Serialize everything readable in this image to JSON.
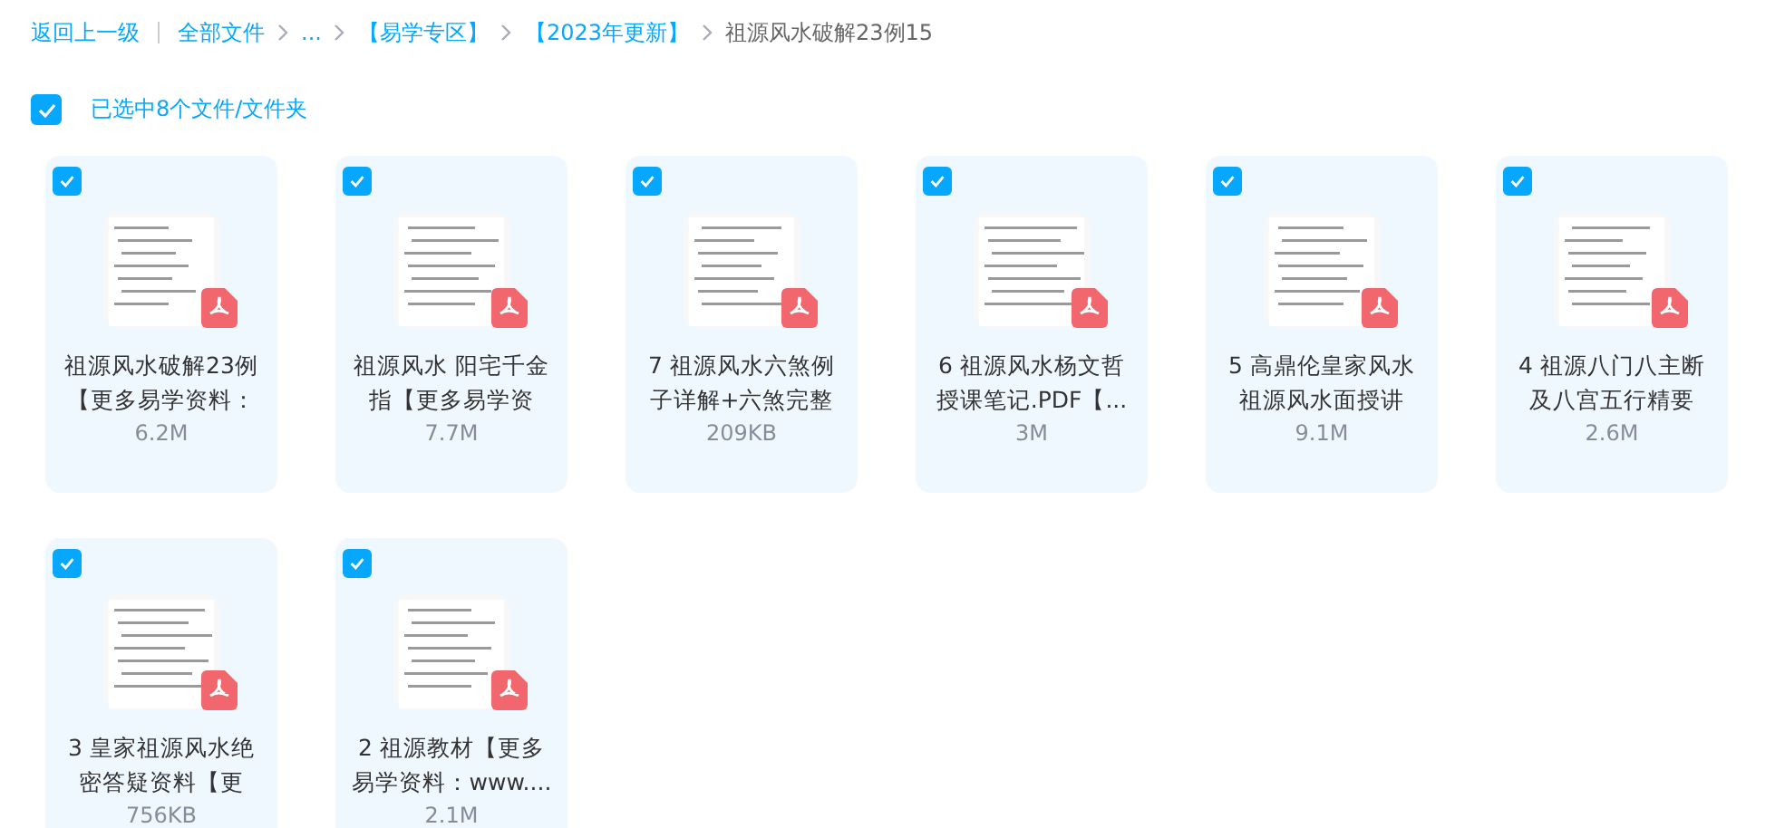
{
  "breadcrumb": {
    "back": "返回上一级",
    "items": [
      {
        "label": "全部文件",
        "current": false
      },
      {
        "label": "...",
        "current": false
      },
      {
        "label": "【易学专区】",
        "current": false
      },
      {
        "label": "【2023年更新】",
        "current": false
      },
      {
        "label": "祖源风水破解23例15",
        "current": true
      }
    ]
  },
  "selection": {
    "checked": true,
    "label": "已选中8个文件/文件夹"
  },
  "files": [
    {
      "name_lines": [
        "祖源风水破解23例",
        "【更多易学资料："
      ],
      "size": "6.2M",
      "checked": true
    },
    {
      "name_lines": [
        "祖源风水 阳宅千金",
        "指【更多易学资"
      ],
      "size": "7.7M",
      "checked": true
    },
    {
      "name_lines": [
        "7 祖源风水六煞例",
        "子详解+六煞完整"
      ],
      "size": "209KB",
      "checked": true
    },
    {
      "name_lines": [
        "6 祖源风水杨文哲",
        "授课笔记.PDF【..."
      ],
      "size": "3M",
      "checked": true
    },
    {
      "name_lines": [
        "5 高鼎伦皇家风水",
        "祖源风水面授讲"
      ],
      "size": "9.1M",
      "checked": true
    },
    {
      "name_lines": [
        "4 祖源八门八主断",
        "及八宫五行精要"
      ],
      "size": "2.6M",
      "checked": true
    },
    {
      "name_lines": [
        "3 皇家祖源风水绝",
        "密答疑资料【更"
      ],
      "size": "756KB",
      "checked": true
    },
    {
      "name_lines": [
        "2 祖源教材【更多",
        "易学资料：www...."
      ],
      "size": "2.1M",
      "checked": true
    }
  ]
}
